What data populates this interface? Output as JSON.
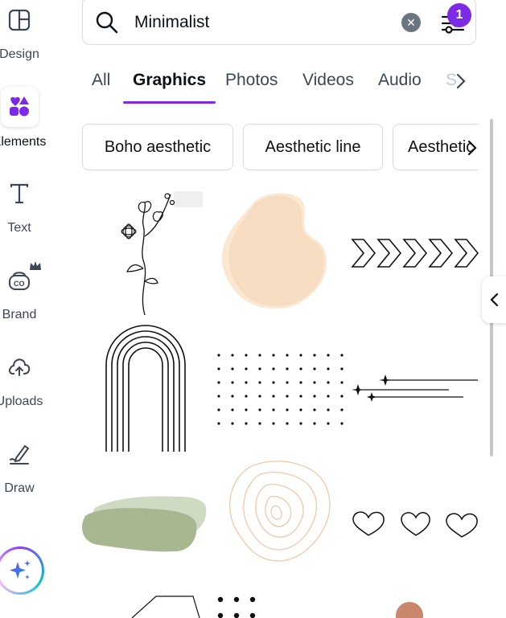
{
  "sidebar": {
    "items": [
      {
        "label": "Design",
        "icon": "layout-icon",
        "active": false
      },
      {
        "label": "Elements",
        "icon": "elements-shapes-icon",
        "active": true
      },
      {
        "label": "Text",
        "icon": "text-t-icon",
        "active": false
      },
      {
        "label": "Brand",
        "icon": "brand-icon",
        "active": false,
        "crown": true
      },
      {
        "label": "Uploads",
        "icon": "cloud-upload-icon",
        "active": false
      },
      {
        "label": "Draw",
        "icon": "pen-draw-icon",
        "active": false
      }
    ],
    "magic_icon": "sparkles-icon"
  },
  "search": {
    "value": "Minimalist",
    "filter_count": "1"
  },
  "tabs": [
    {
      "label": "All",
      "active": false
    },
    {
      "label": "Graphics",
      "active": true
    },
    {
      "label": "Photos",
      "active": false
    },
    {
      "label": "Videos",
      "active": false
    },
    {
      "label": "Audio",
      "active": false
    },
    {
      "label": "S",
      "active": false
    }
  ],
  "chips": [
    "Boho aesthetic",
    "Aesthetic line",
    "Aesthetic"
  ],
  "results": [
    "line-flower-graphic",
    "peach-blob-graphic",
    "chevron-arrows-graphic",
    "rainbow-arch-lines-graphic",
    "dot-grid-graphic",
    "shooting-stars-graphic",
    "sage-brush-stroke-graphic",
    "topographic-lines-graphic",
    "three-hearts-graphic",
    "hexagon-outline-graphic",
    "dot-pattern-graphic",
    "terracotta-circle-graphic"
  ],
  "colors": {
    "accent": "#7d2ae8",
    "peach": "#f6dcc0",
    "sage": "#a7b891",
    "terracotta": "#c9876b"
  }
}
